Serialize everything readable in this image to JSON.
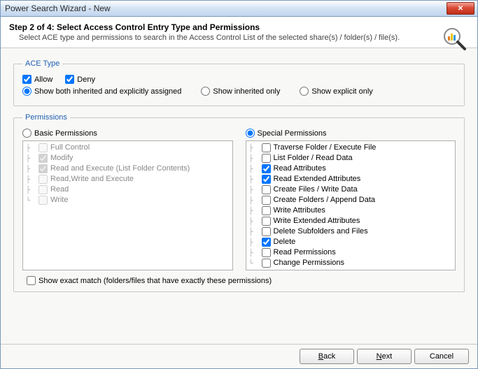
{
  "window": {
    "title": "Power Search Wizard - New"
  },
  "header": {
    "title": "Step 2 of 4: Select Access Control Entry Type and Permissions",
    "subtitle": "Select ACE type and permissions to search in the Access Control List of the selected share(s) / folder(s) / file(s)."
  },
  "ace_type": {
    "legend": "ACE Type",
    "allow": {
      "label": "Allow",
      "checked": true
    },
    "deny": {
      "label": "Deny",
      "checked": true
    },
    "show_mode": "both",
    "show_both_label": "Show both inherited and explicitly assigned",
    "show_inherited_label": "Show inherited only",
    "show_explicit_label": "Show explicit only"
  },
  "permissions": {
    "legend": "Permissions",
    "mode": "special",
    "basic_label": "Basic Permissions",
    "special_label": "Special Permissions",
    "basic_items": [
      {
        "label": "Full Control",
        "checked": false
      },
      {
        "label": "Modify",
        "checked": true
      },
      {
        "label": "Read and Execute (List Folder Contents)",
        "checked": true
      },
      {
        "label": "Read,Write and Execute",
        "checked": false
      },
      {
        "label": "Read",
        "checked": false
      },
      {
        "label": "Write",
        "checked": false
      }
    ],
    "special_items": [
      {
        "label": "Traverse Folder / Execute File",
        "checked": false
      },
      {
        "label": "List Folder / Read Data",
        "checked": false
      },
      {
        "label": "Read Attributes",
        "checked": true
      },
      {
        "label": "Read Extended Attributes",
        "checked": true
      },
      {
        "label": "Create Files / Write Data",
        "checked": false
      },
      {
        "label": "Create Folders / Append Data",
        "checked": false
      },
      {
        "label": "Write Attributes",
        "checked": false
      },
      {
        "label": "Write Extended Attributes",
        "checked": false
      },
      {
        "label": "Delete Subfolders and Files",
        "checked": false
      },
      {
        "label": "Delete",
        "checked": true
      },
      {
        "label": "Read Permissions",
        "checked": false
      },
      {
        "label": "Change Permissions",
        "checked": false
      }
    ]
  },
  "exact_match": {
    "label": "Show exact match (folders/files that have exactly these permissions)",
    "checked": false
  },
  "buttons": {
    "back": "Back",
    "next": "Next",
    "cancel": "Cancel"
  }
}
